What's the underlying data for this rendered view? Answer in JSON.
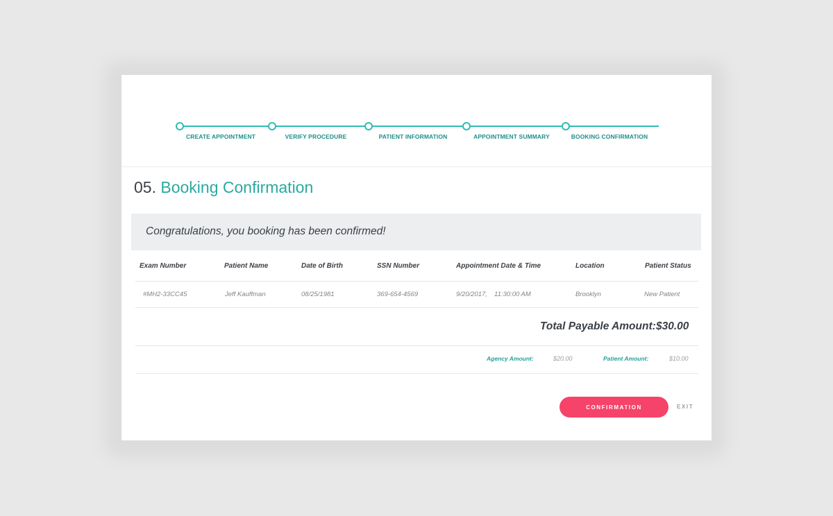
{
  "steps": [
    {
      "label": "CREATE APPOINTMENT"
    },
    {
      "label": "VERIFY PROCEDURE"
    },
    {
      "label": "PATIENT INFORMATION"
    },
    {
      "label": "APPOINTMENT SUMMARY"
    },
    {
      "label": "BOOKING CONFIRMATION"
    }
  ],
  "heading": {
    "number": "05.",
    "title": "Booking Confirmation"
  },
  "banner": {
    "text": "Congratulations, you booking has been confirmed!"
  },
  "table": {
    "columns": [
      "Exam Number",
      "Patient Name",
      "Date of Birth",
      "SSN Number",
      "Appointment Date & Time",
      "Location",
      "Patient Status"
    ],
    "row": {
      "exam_number": "#MH2-33CC45",
      "patient_name": "Jeff Kauffman",
      "date_of_birth": "08/25/1981",
      "ssn_number": "369-654-4569",
      "appointment_date": "9/20/2017,",
      "appointment_time": "11:30:00 AM",
      "location": "Brooklyn",
      "patient_status": "New Patient"
    }
  },
  "totals": {
    "total_label": "Total Payable Amount:",
    "total_value": "$30.00",
    "agency_label": "Agency Amount:",
    "agency_value": "$20.00",
    "patient_label": "Patient Amount:",
    "patient_value": "$10.00"
  },
  "actions": {
    "confirm_label": "CONFIRMATION",
    "exit_label": "EXIT"
  },
  "colors": {
    "accent": "#2dbdb1",
    "button": "#f5436a",
    "banner_bg": "#eceef0"
  }
}
